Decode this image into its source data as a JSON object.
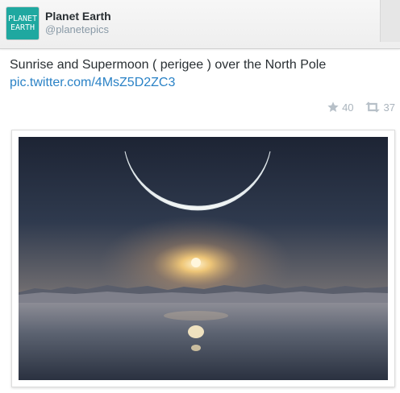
{
  "profile": {
    "avatar_line1": "PLANET",
    "avatar_line2": "EARTH",
    "name": "Planet Earth",
    "handle": "@planetepics"
  },
  "tweet": {
    "text": "Sunrise and Supermoon ( perigee ) over the North Pole",
    "link": "pic.twitter.com/4MsZ5D2ZC3",
    "favorites": "40",
    "retweets": "37"
  },
  "colors": {
    "avatar_bg": "#1fa8a0",
    "link": "#2a82c6",
    "muted": "#aab4bd"
  },
  "icons": {
    "favorite": "star-icon",
    "retweet": "retweet-icon"
  }
}
